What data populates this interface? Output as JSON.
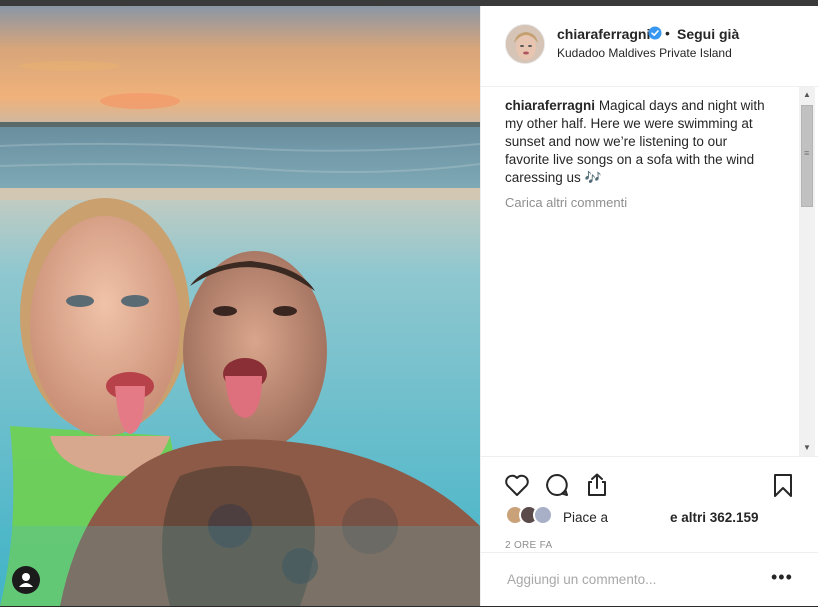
{
  "post": {
    "username": "chiaraferragni",
    "separator": "•",
    "follow_label": "Segui già",
    "location": "Kudadoo Maldives Private Island",
    "caption_user": "chiaraferragni",
    "caption_text": "Magical days and night with my other half. Here we were swimming at sunset and now we’re listening to our favorite live songs on a sofa with the wind caressing us",
    "caption_emoji": "🎶",
    "load_more": "Carica altri commenti",
    "likes_prefix": "Piace a",
    "likes_suffix": "e altri 362.159",
    "time_ago": "2 ORE FA",
    "add_comment_placeholder": "Aggiungi un commento...",
    "more_label": "•••"
  },
  "icons": {
    "like": "heart-icon",
    "comment": "comment-icon",
    "share": "share-icon",
    "save": "bookmark-icon",
    "verified": "verified-badge-icon",
    "user_tag": "user-tag-icon"
  },
  "colors": {
    "verified_blue": "#3897f0",
    "text": "#262626",
    "muted": "#8e8e8e",
    "border": "#efefef"
  }
}
